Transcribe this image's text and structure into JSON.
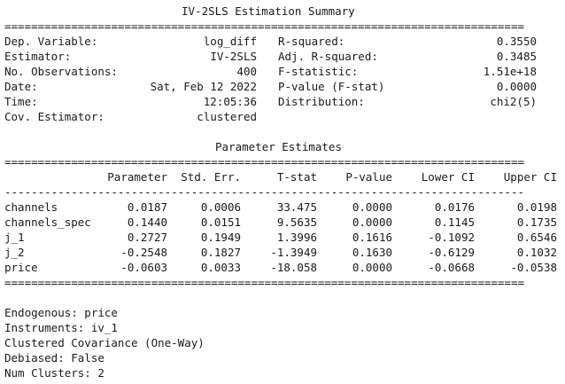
{
  "title": "IV-2SLS Estimation Summary",
  "summary_left": [
    {
      "label": "Dep. Variable:",
      "value": "log_diff"
    },
    {
      "label": "Estimator:",
      "value": "IV-2SLS"
    },
    {
      "label": "No. Observations:",
      "value": "400"
    },
    {
      "label": "Date:",
      "value": "Sat, Feb 12 2022"
    },
    {
      "label": "Time:",
      "value": "12:05:36"
    },
    {
      "label": "Cov. Estimator:",
      "value": "clustered"
    }
  ],
  "summary_right": [
    {
      "label": "R-squared:",
      "value": "0.3550"
    },
    {
      "label": "Adj. R-squared:",
      "value": "0.3485"
    },
    {
      "label": "F-statistic:",
      "value": "1.51e+18"
    },
    {
      "label": "P-value (F-stat)",
      "value": "0.0000"
    },
    {
      "label": "Distribution:",
      "value": "chi2(5)"
    }
  ],
  "param_title": "Parameter Estimates",
  "columns": [
    "Parameter",
    "Std. Err.",
    "T-stat",
    "P-value",
    "Lower CI",
    "Upper CI"
  ],
  "rows": [
    {
      "name": "channels",
      "cells": [
        "0.0187",
        "0.0006",
        "33.475",
        "0.0000",
        "0.0176",
        "0.0198"
      ]
    },
    {
      "name": "channels_spec",
      "cells": [
        "0.1440",
        "0.0151",
        "9.5635",
        "0.0000",
        "0.1145",
        "0.1735"
      ]
    },
    {
      "name": "j_1",
      "cells": [
        "0.2727",
        "0.1949",
        "1.3996",
        "0.1616",
        "-0.1092",
        "0.6546"
      ]
    },
    {
      "name": "j_2",
      "cells": [
        "-0.2548",
        "0.1827",
        "-1.3949",
        "0.1630",
        "-0.6129",
        "0.1032"
      ]
    },
    {
      "name": "price",
      "cells": [
        "-0.0603",
        "0.0033",
        "-18.058",
        "0.0000",
        "-0.0668",
        "-0.0538"
      ]
    }
  ],
  "footer_notes": [
    "Endogenous: price",
    "Instruments: iv_1",
    "Clustered Covariance (One-Way)",
    "Debiased: False",
    "Num Clusters: 2"
  ],
  "rules": {
    "double": "==============================================================================",
    "single": "------------------------------------------------------------------------------"
  }
}
